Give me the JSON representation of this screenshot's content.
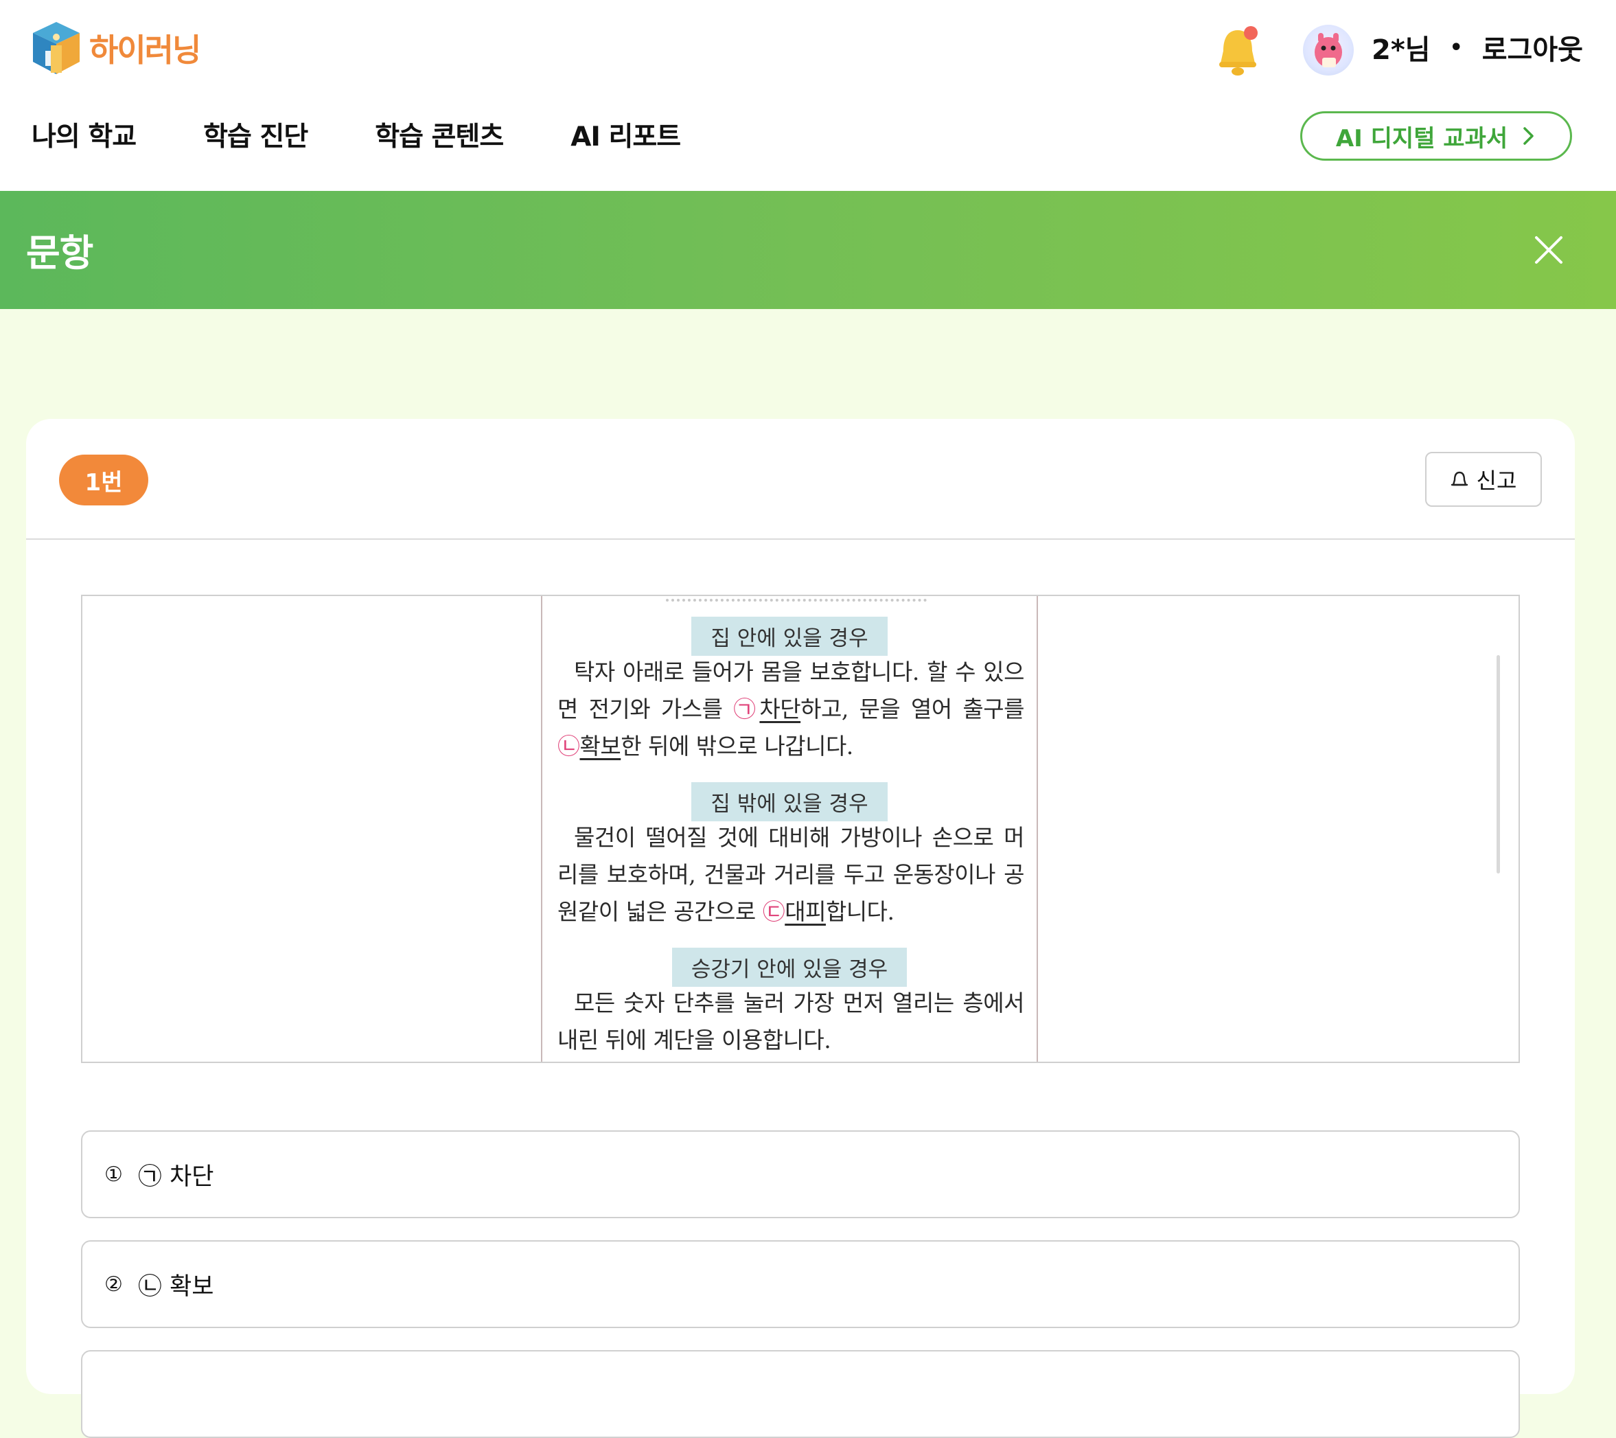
{
  "header": {
    "logo_text": "하이러닝",
    "user_name": "2*님",
    "separator": "•",
    "logout_label": "로그아웃",
    "nav": [
      {
        "label": "나의 학교"
      },
      {
        "label": "학습 진단"
      },
      {
        "label": "학습 콘텐츠"
      },
      {
        "label": "AI 리포트"
      }
    ],
    "ai_textbook_label": "AI 디지털 교과서",
    "ai_textbook_chevron": "›"
  },
  "band": {
    "title": "문항"
  },
  "question": {
    "number_label": "1번",
    "report_label": "신고",
    "passage": {
      "sections": [
        {
          "heading": "집 안에 있을 경우",
          "text_a": "탁자 아래로 들어가 몸을 보호합니다. 할 수 있으면 전기와 가스를 ",
          "mark1": "㉠",
          "word1": "차단",
          "text_b": "하고, 문을 열어 출구를 ",
          "mark2": "㉡",
          "word2": "확보",
          "text_c": "한 뒤에 밖으로 나갑니다."
        },
        {
          "heading": "집 밖에 있을 경우",
          "text_a": "물건이 떨어질 것에 대비해 가방이나 손으로 머리를 보호하며, 건물과 거리를 두고 운동장이나 공원같이 넓은 공간으로 ",
          "mark1": "㉢",
          "word1": "대피",
          "text_b": "합니다."
        },
        {
          "heading": "승강기 안에 있을 경우",
          "text_a": "모든 숫자 단추를 눌러 가장 먼저 열리는 층에서 내린 뒤에 계단을 이용합니다."
        }
      ]
    },
    "options": [
      {
        "num": "①",
        "mark": "㉠",
        "text": "차단"
      },
      {
        "num": "②",
        "mark": "㉡",
        "text": "확보"
      }
    ]
  },
  "colors": {
    "brand_orange": "#f2893a",
    "brand_green": "#5bb84e",
    "band_start": "#5cb85b",
    "band_end": "#86c74a",
    "page_bg": "#f5fde6",
    "marker_pink": "#e0457b"
  },
  "icons": [
    "logo-icon",
    "bell-icon",
    "avatar",
    "chevron-right-icon",
    "close-icon",
    "bell-outline-icon"
  ]
}
